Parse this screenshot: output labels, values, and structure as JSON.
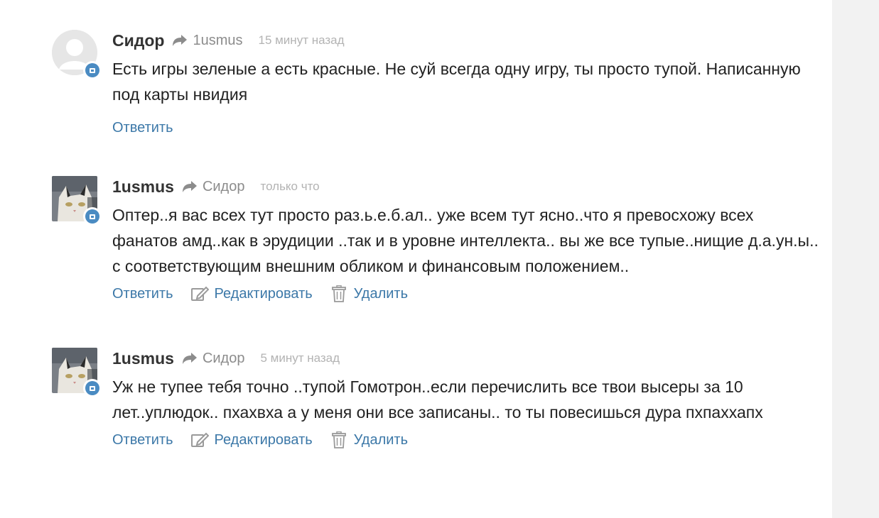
{
  "comments": [
    {
      "author": "Сидор",
      "reply_to": "1usmus",
      "time": "15 минут назад",
      "text": "Есть игры зеленые а есть красные. Не суй всегда одну игру, ты просто тупой. Написанную под карты нвидия",
      "avatar": "default-avatar",
      "actions": {
        "reply": "Ответить"
      }
    },
    {
      "author": "1usmus",
      "reply_to": "Сидор",
      "time": "только что",
      "text": "Оптер..я вас всех тут просто раз.ь.е.б.ал.. уже всем тут ясно..что я превосхожу всех фанатов амд..как в эрудиции ..так и в уровне интеллекта.. вы же все тупые..нищие д.а.ун.ы.. с соответствующим внешним обликом и финансовым положением..",
      "avatar": "cat-avatar",
      "actions": {
        "reply": "Ответить",
        "edit": "Редактировать",
        "delete": "Удалить"
      }
    },
    {
      "author": "1usmus",
      "reply_to": "Сидор",
      "time": "5 минут назад",
      "text": "Уж не тупее тебя точно ..тупой Гомотрон..если перечислить все твои высеры за 10 лет..уплюдок.. пхахвха  а у меня они все записаны.. то ты повесишься дура пхпаххапх",
      "avatar": "cat-avatar",
      "actions": {
        "reply": "Ответить",
        "edit": "Редактировать",
        "delete": "Удалить"
      }
    }
  ],
  "colors": {
    "link": "#3c78a8",
    "badge": "#4a8bc2",
    "muted": "#8c8c8c",
    "panel": "#f2f2f2"
  }
}
